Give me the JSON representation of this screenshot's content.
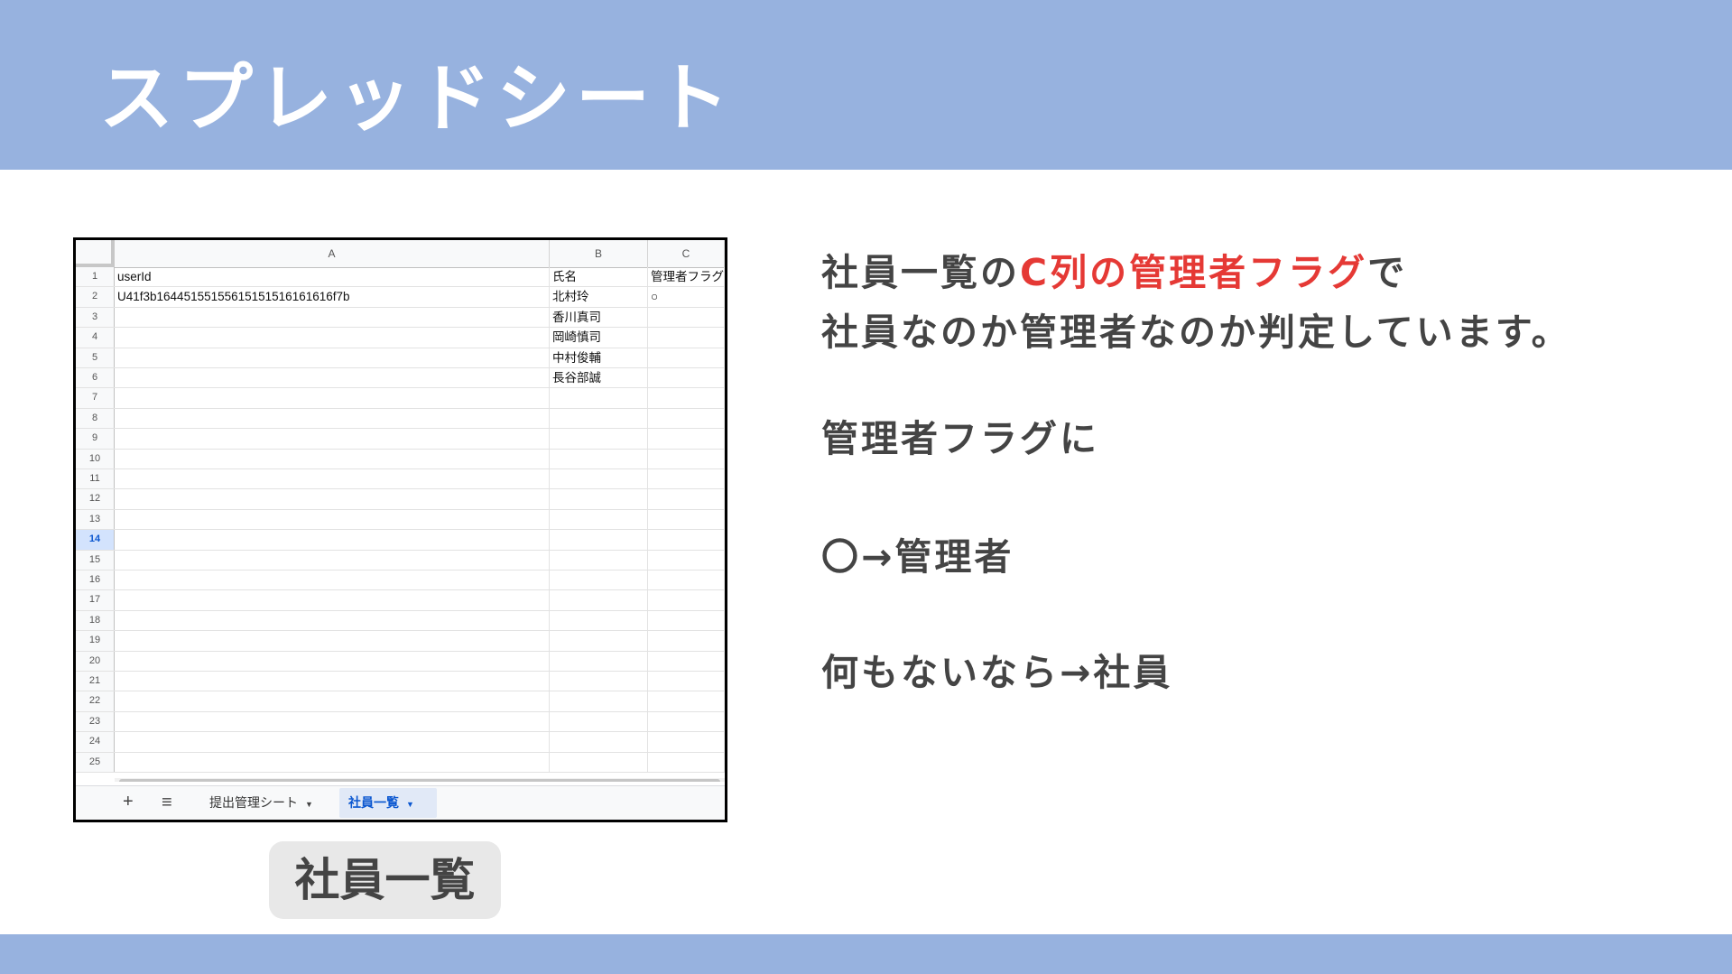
{
  "slide": {
    "title": "スプレッドシート",
    "caption": "社員一覧"
  },
  "sheet": {
    "column_headers": [
      "A",
      "B",
      "C"
    ],
    "rows": [
      {
        "num": "1",
        "a": "userId",
        "b": "氏名",
        "c": "管理者フラグ"
      },
      {
        "num": "2",
        "a": "U41f3b16445155155615151516161616f7b",
        "b": "北村玲",
        "c": "○"
      },
      {
        "num": "3",
        "a": "",
        "b": "香川真司",
        "c": ""
      },
      {
        "num": "4",
        "a": "",
        "b": "岡崎慎司",
        "c": ""
      },
      {
        "num": "5",
        "a": "",
        "b": "中村俊輔",
        "c": ""
      },
      {
        "num": "6",
        "a": "",
        "b": "長谷部誠",
        "c": ""
      },
      {
        "num": "7",
        "a": "",
        "b": "",
        "c": ""
      },
      {
        "num": "8",
        "a": "",
        "b": "",
        "c": ""
      },
      {
        "num": "9",
        "a": "",
        "b": "",
        "c": ""
      },
      {
        "num": "10",
        "a": "",
        "b": "",
        "c": ""
      },
      {
        "num": "11",
        "a": "",
        "b": "",
        "c": ""
      },
      {
        "num": "12",
        "a": "",
        "b": "",
        "c": ""
      },
      {
        "num": "13",
        "a": "",
        "b": "",
        "c": ""
      },
      {
        "num": "14",
        "a": "",
        "b": "",
        "c": "",
        "active": true
      },
      {
        "num": "15",
        "a": "",
        "b": "",
        "c": ""
      },
      {
        "num": "16",
        "a": "",
        "b": "",
        "c": ""
      },
      {
        "num": "17",
        "a": "",
        "b": "",
        "c": ""
      },
      {
        "num": "18",
        "a": "",
        "b": "",
        "c": ""
      },
      {
        "num": "19",
        "a": "",
        "b": "",
        "c": ""
      },
      {
        "num": "20",
        "a": "",
        "b": "",
        "c": ""
      },
      {
        "num": "21",
        "a": "",
        "b": "",
        "c": ""
      },
      {
        "num": "22",
        "a": "",
        "b": "",
        "c": ""
      },
      {
        "num": "23",
        "a": "",
        "b": "",
        "c": ""
      },
      {
        "num": "24",
        "a": "",
        "b": "",
        "c": ""
      },
      {
        "num": "25",
        "a": "",
        "b": "",
        "c": ""
      }
    ],
    "tabs": {
      "add_icon": "+",
      "menu_icon": "≡",
      "items": [
        {
          "label": "提出管理シート",
          "active": false
        },
        {
          "label": "社員一覧",
          "active": true
        }
      ]
    }
  },
  "explanation": {
    "line1_prefix": "社員一覧の",
    "line1_highlight": "C列の管理者フラグ",
    "line1_suffix": "で",
    "line2": "社員なのか管理者なのか判定しています。",
    "line3": "管理者フラグに",
    "line4": "〇→管理者",
    "line5": "何もないなら→社員"
  },
  "colors": {
    "band": "#97b2df",
    "highlight": "#e53935",
    "text": "#444444"
  }
}
